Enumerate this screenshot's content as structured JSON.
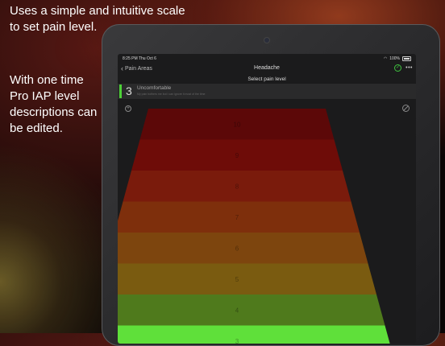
{
  "promo": {
    "line1": "Uses a simple and intuitive scale to set pain level.",
    "line2": "With one time Pro IAP level descriptions can be edited."
  },
  "status_bar": {
    "time": "8:25 PM",
    "date": "Thu Oct 6",
    "battery": "100%"
  },
  "nav": {
    "back_label": "Pain Areas",
    "title": "Headache",
    "icons": [
      "check-circle-icon",
      "more-icon"
    ]
  },
  "subtitle": "Select pain level",
  "selected": {
    "level": "3",
    "name": "Uncomfortable",
    "description": "My pain bothers me but I can ignore it most of the time",
    "accent": "#4cd137"
  },
  "scale": {
    "levels": [
      {
        "label": "10",
        "color": "#5c0808"
      },
      {
        "label": "9",
        "color": "#6e0c08"
      },
      {
        "label": "8",
        "color": "#7a1b0c"
      },
      {
        "label": "7",
        "color": "#7e2f0c"
      },
      {
        "label": "6",
        "color": "#7d450e"
      },
      {
        "label": "5",
        "color": "#7a5b10"
      },
      {
        "label": "4",
        "color": "#4f7a1c"
      },
      {
        "label": "3",
        "color": "#5fe03a"
      }
    ]
  }
}
